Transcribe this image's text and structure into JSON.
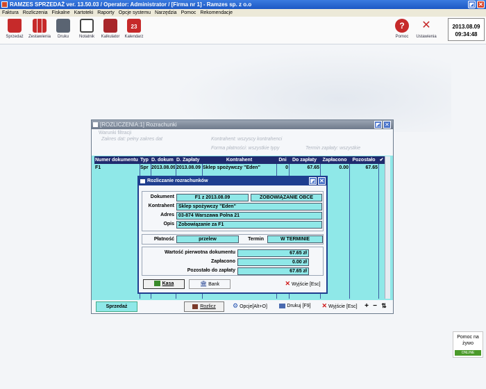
{
  "app": {
    "title": "RAMZES SPRZEDAŻ ver. 13.50.03 /  Operator: Administrator /  [Firma nr 1] - Ramzes sp. z o.o"
  },
  "menu": [
    "Faktura",
    "Rozliczenia",
    "Fiskalne",
    "Kartoteki",
    "Raporty",
    "Opcje systemu",
    "Narzędzia",
    "Pomoc",
    "Rekomendacje"
  ],
  "toolbar": {
    "left": [
      {
        "label": "Sprzedaż",
        "icon": "bag-icon"
      },
      {
        "label": "Zestawienia",
        "icon": "bar-chart-icon"
      },
      {
        "label": "Druku",
        "icon": "printer-icon"
      },
      {
        "label": "Notatnik",
        "icon": "notepad-icon"
      },
      {
        "label": "Kalkulator",
        "icon": "calculator-icon"
      },
      {
        "label": "Kalendarz",
        "icon": "calendar-icon"
      }
    ],
    "right": [
      {
        "label": "Pomoc",
        "icon": "help-icon"
      },
      {
        "label": "Ustawienia",
        "icon": "tools-icon"
      }
    ],
    "calendar_day": "23",
    "date": "2013.08.09",
    "time": "09:34:48"
  },
  "window": {
    "title": "[ROZLICZENIA:1]  Rozrachunki",
    "filter": {
      "title": "Warunki filtracji",
      "zakres": "Zakres dat:  pełny zakres dat",
      "kontrahent": "Kontrahent: wszyscy kontrahenci",
      "forma": "Forma płatności: wszystkie typy",
      "termin": "Termin zapłaty:  wszystkie"
    },
    "columns": [
      "Numer dokumentu",
      "Typ",
      "D. dokum",
      "D. Zapłaty",
      "Kontrahent",
      "Dni",
      "Do zapłaty",
      "Zapłacono",
      "Pozostało",
      "✔"
    ],
    "row": [
      "F1",
      "Spr",
      "2013.08.09",
      "2013.08.09",
      "Sklep spożywczy \"Eden\"",
      "0",
      "67.65",
      "0.00",
      "67.65",
      ""
    ],
    "buttons": {
      "sprzedaz": "Sprzedaż",
      "rozlicz": "Rozlicz",
      "opcje": "Opcje[Alt+O]",
      "drukuj": "Drukuj  [F9]",
      "wyjscie": "Wyjście [Esc]"
    }
  },
  "dialog": {
    "title": "Rozliczanie rozrachunków",
    "dokument_label": "Dokument",
    "dokument_value": "F1 z 2013.08.09",
    "dokument_type": "ZOBOWIĄZANIE OBCE",
    "kontrahent_label": "Kontrahent",
    "kontrahent_value": "Sklep spożywczy \"Eden\"",
    "adres_label": "Adres",
    "adres_value": "03-874 Warszawa Polna 21",
    "opis_label": "Opis",
    "opis_value": "Zobowiązanie za F1",
    "platnosc_label": "Płatność",
    "platnosc_value": "przelew",
    "termin_label": "Termin",
    "termin_value": "W TERMINIE",
    "wartosc_label": "Wartość pierwotna dokumentu",
    "wartosc_value": "67.65 zł",
    "zaplacono_label": "Zapłacono",
    "zaplacono_value": "0.00 zł",
    "pozostalo_label": "Pozostało do zapłaty",
    "pozostalo_value": "67.65 zł",
    "kasa": "Kasa",
    "bank": "Bank",
    "wyjscie": "Wyjście  [Esc]"
  },
  "help": {
    "text": "Pomoc na żywo",
    "status": "ONLINE"
  }
}
